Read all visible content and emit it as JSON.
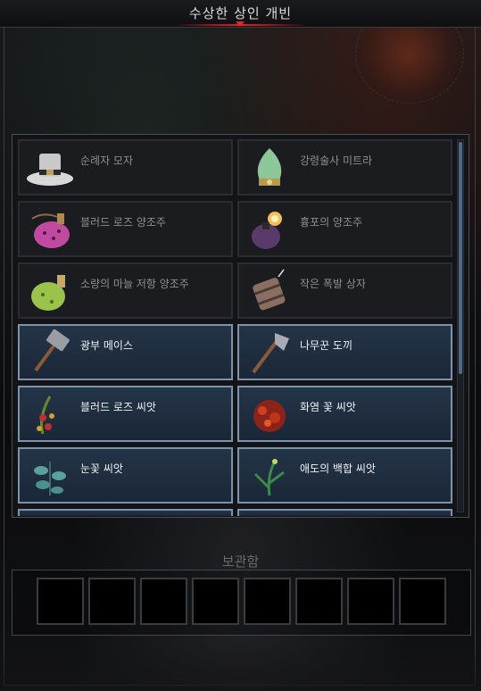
{
  "window": {
    "title": "수상한 상인 개빈"
  },
  "items": [
    {
      "label": "순례자 모자",
      "icon": "pilgrim-hat-icon",
      "available": false
    },
    {
      "label": "강령술사 미트라",
      "icon": "necromancer-mitre-icon",
      "available": false
    },
    {
      "label": "블러드 로즈 양조주",
      "icon": "blood-rose-brew-icon",
      "available": false
    },
    {
      "label": "흉포의 양조주",
      "icon": "ferocity-brew-icon",
      "available": false
    },
    {
      "label": "소량의 마늘 저항 양조주",
      "icon": "garlic-resistance-brew-icon",
      "available": false
    },
    {
      "label": "작은 폭발 상자",
      "icon": "small-explosive-box-icon",
      "available": false
    },
    {
      "label": "광부 메이스",
      "icon": "miner-mace-icon",
      "available": true
    },
    {
      "label": "나무꾼 도끼",
      "icon": "woodcutter-axe-icon",
      "available": true
    },
    {
      "label": "블러드 로즈 씨앗",
      "icon": "blood-rose-seed-icon",
      "available": true
    },
    {
      "label": "화염 꽃 씨앗",
      "icon": "fire-flower-seed-icon",
      "available": true
    },
    {
      "label": "눈꽃 씨앗",
      "icon": "snow-flower-seed-icon",
      "available": true
    },
    {
      "label": "애도의 백합 씨앗",
      "icon": "mourning-lily-seed-icon",
      "available": true
    }
  ],
  "storage": {
    "title": "보관함",
    "slots": [
      {},
      {},
      {},
      {},
      {},
      {},
      {},
      {}
    ]
  },
  "colors": {
    "accent_red": "#e02020",
    "available_border": "#7f93a8",
    "available_bg": "#243447",
    "unavailable_bg": "#1b1c1f"
  }
}
